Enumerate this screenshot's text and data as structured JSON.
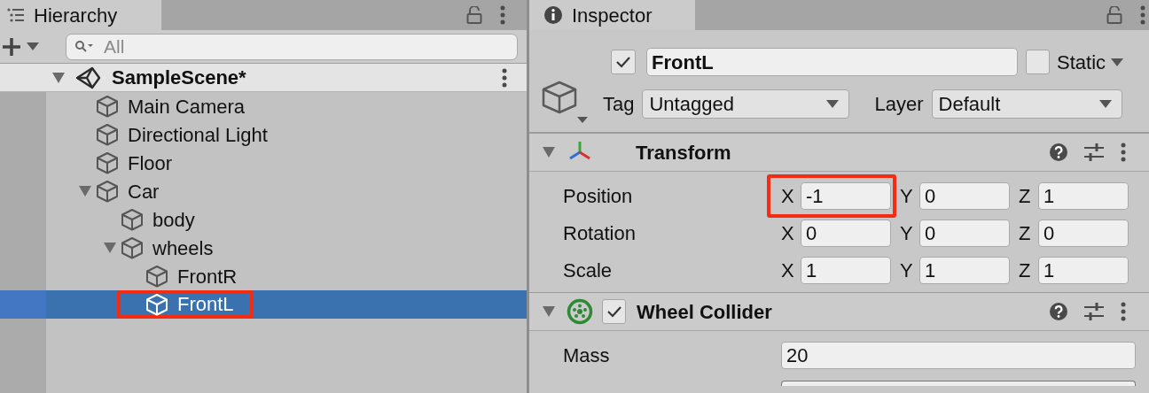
{
  "hierarchy": {
    "tab_title": "Hierarchy",
    "search": {
      "placeholder": "All"
    },
    "scene": {
      "name": "SampleScene*",
      "expanded": true
    },
    "items": [
      {
        "name": "Main Camera",
        "selected": false,
        "highlighted": false
      },
      {
        "name": "Directional Light",
        "selected": false,
        "highlighted": false
      },
      {
        "name": "Floor",
        "selected": false,
        "highlighted": false
      },
      {
        "name": "Car",
        "selected": false,
        "highlighted": false,
        "expanded": true,
        "children": [
          {
            "name": "body",
            "selected": false,
            "highlighted": false
          },
          {
            "name": "wheels",
            "selected": false,
            "highlighted": false,
            "expanded": true,
            "children": [
              {
                "name": "FrontR",
                "selected": false,
                "highlighted": false
              },
              {
                "name": "FrontL",
                "selected": true,
                "highlighted": true
              }
            ]
          }
        ]
      }
    ]
  },
  "inspector": {
    "tab_title": "Inspector",
    "object": {
      "active": true,
      "name": "FrontL",
      "static": false,
      "static_label": "Static",
      "tag_label": "Tag",
      "tag": "Untagged",
      "layer_label": "Layer",
      "layer": "Default"
    },
    "components": [
      {
        "kind": "transform",
        "title": "Transform",
        "expanded": true,
        "rows": [
          {
            "label": "Position",
            "fields": [
              {
                "axis": "X",
                "value": "-1",
                "highlighted": true
              },
              {
                "axis": "Y",
                "value": "0",
                "highlighted": false
              },
              {
                "axis": "Z",
                "value": "1",
                "highlighted": false
              }
            ]
          },
          {
            "label": "Rotation",
            "fields": [
              {
                "axis": "X",
                "value": "0",
                "highlighted": false
              },
              {
                "axis": "Y",
                "value": "0",
                "highlighted": false
              },
              {
                "axis": "Z",
                "value": "0",
                "highlighted": false
              }
            ]
          },
          {
            "label": "Scale",
            "fields": [
              {
                "axis": "X",
                "value": "1",
                "highlighted": false
              },
              {
                "axis": "Y",
                "value": "1",
                "highlighted": false
              },
              {
                "axis": "Z",
                "value": "1",
                "highlighted": false
              }
            ]
          }
        ]
      },
      {
        "kind": "wheel_collider",
        "title": "Wheel Collider",
        "expanded": true,
        "enabled": true,
        "rows": [
          {
            "label": "Mass",
            "value": "20"
          }
        ]
      }
    ]
  }
}
